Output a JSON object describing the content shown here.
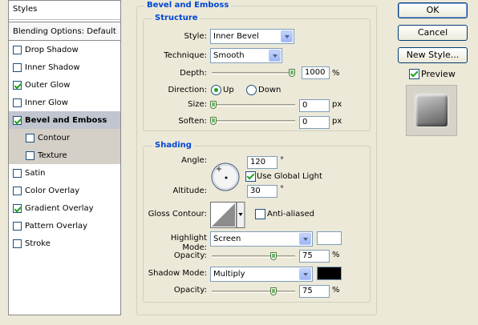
{
  "styles_panel": {
    "title": "Styles",
    "blending": "Blending Options: Default",
    "items": [
      {
        "label": "Drop Shadow",
        "checked": false
      },
      {
        "label": "Inner Shadow",
        "checked": false
      },
      {
        "label": "Outer Glow",
        "checked": true
      },
      {
        "label": "Inner Glow",
        "checked": false
      },
      {
        "label": "Bevel and Emboss",
        "checked": true,
        "selected": true
      },
      {
        "label": "Contour",
        "checked": false,
        "sub": true
      },
      {
        "label": "Texture",
        "checked": false,
        "sub": true
      },
      {
        "label": "Satin",
        "checked": false
      },
      {
        "label": "Color Overlay",
        "checked": false
      },
      {
        "label": "Gradient Overlay",
        "checked": true
      },
      {
        "label": "Pattern Overlay",
        "checked": false
      },
      {
        "label": "Stroke",
        "checked": false
      }
    ]
  },
  "bevel": {
    "title": "Bevel and Emboss",
    "structure": {
      "title": "Structure",
      "style_label": "Style:",
      "style_value": "Inner Bevel",
      "technique_label": "Technique:",
      "technique_value": "Smooth",
      "depth_label": "Depth:",
      "depth_value": "1000",
      "depth_unit": "%",
      "direction_label": "Direction:",
      "dir_up": "Up",
      "dir_down": "Down",
      "direction_selected": "Up",
      "size_label": "Size:",
      "size_value": "0",
      "size_unit": "px",
      "soften_label": "Soften:",
      "soften_value": "0",
      "soften_unit": "px"
    },
    "shading": {
      "title": "Shading",
      "angle_label": "Angle:",
      "angle_value": "120",
      "angle_unit": "°",
      "global_light_label": "Use Global Light",
      "global_light_checked": true,
      "altitude_label": "Altitude:",
      "altitude_value": "30",
      "altitude_unit": "°",
      "gloss_label": "Gloss Contour:",
      "antialiased_label": "Anti-aliased",
      "antialiased_checked": false,
      "highlight_mode_label": "Highlight Mode:",
      "highlight_mode_value": "Screen",
      "highlight_color": "#ffffff",
      "highlight_opacity_label": "Opacity:",
      "highlight_opacity_value": "75",
      "highlight_opacity_unit": "%",
      "shadow_mode_label": "Shadow Mode:",
      "shadow_mode_value": "Multiply",
      "shadow_color": "#000000",
      "shadow_opacity_label": "Opacity:",
      "shadow_opacity_value": "75",
      "shadow_opacity_unit": "%"
    }
  },
  "buttons": {
    "ok": "OK",
    "cancel": "Cancel",
    "new_style": "New Style...",
    "preview_label": "Preview",
    "preview_checked": true
  }
}
